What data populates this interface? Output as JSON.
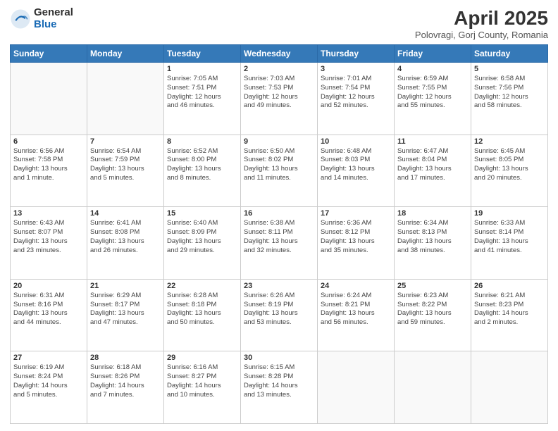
{
  "header": {
    "logo_general": "General",
    "logo_blue": "Blue",
    "month_title": "April 2025",
    "location": "Polovragi, Gorj County, Romania"
  },
  "days_of_week": [
    "Sunday",
    "Monday",
    "Tuesday",
    "Wednesday",
    "Thursday",
    "Friday",
    "Saturday"
  ],
  "weeks": [
    [
      {
        "day": "",
        "info": ""
      },
      {
        "day": "",
        "info": ""
      },
      {
        "day": "1",
        "info": "Sunrise: 7:05 AM\nSunset: 7:51 PM\nDaylight: 12 hours\nand 46 minutes."
      },
      {
        "day": "2",
        "info": "Sunrise: 7:03 AM\nSunset: 7:53 PM\nDaylight: 12 hours\nand 49 minutes."
      },
      {
        "day": "3",
        "info": "Sunrise: 7:01 AM\nSunset: 7:54 PM\nDaylight: 12 hours\nand 52 minutes."
      },
      {
        "day": "4",
        "info": "Sunrise: 6:59 AM\nSunset: 7:55 PM\nDaylight: 12 hours\nand 55 minutes."
      },
      {
        "day": "5",
        "info": "Sunrise: 6:58 AM\nSunset: 7:56 PM\nDaylight: 12 hours\nand 58 minutes."
      }
    ],
    [
      {
        "day": "6",
        "info": "Sunrise: 6:56 AM\nSunset: 7:58 PM\nDaylight: 13 hours\nand 1 minute."
      },
      {
        "day": "7",
        "info": "Sunrise: 6:54 AM\nSunset: 7:59 PM\nDaylight: 13 hours\nand 5 minutes."
      },
      {
        "day": "8",
        "info": "Sunrise: 6:52 AM\nSunset: 8:00 PM\nDaylight: 13 hours\nand 8 minutes."
      },
      {
        "day": "9",
        "info": "Sunrise: 6:50 AM\nSunset: 8:02 PM\nDaylight: 13 hours\nand 11 minutes."
      },
      {
        "day": "10",
        "info": "Sunrise: 6:48 AM\nSunset: 8:03 PM\nDaylight: 13 hours\nand 14 minutes."
      },
      {
        "day": "11",
        "info": "Sunrise: 6:47 AM\nSunset: 8:04 PM\nDaylight: 13 hours\nand 17 minutes."
      },
      {
        "day": "12",
        "info": "Sunrise: 6:45 AM\nSunset: 8:05 PM\nDaylight: 13 hours\nand 20 minutes."
      }
    ],
    [
      {
        "day": "13",
        "info": "Sunrise: 6:43 AM\nSunset: 8:07 PM\nDaylight: 13 hours\nand 23 minutes."
      },
      {
        "day": "14",
        "info": "Sunrise: 6:41 AM\nSunset: 8:08 PM\nDaylight: 13 hours\nand 26 minutes."
      },
      {
        "day": "15",
        "info": "Sunrise: 6:40 AM\nSunset: 8:09 PM\nDaylight: 13 hours\nand 29 minutes."
      },
      {
        "day": "16",
        "info": "Sunrise: 6:38 AM\nSunset: 8:11 PM\nDaylight: 13 hours\nand 32 minutes."
      },
      {
        "day": "17",
        "info": "Sunrise: 6:36 AM\nSunset: 8:12 PM\nDaylight: 13 hours\nand 35 minutes."
      },
      {
        "day": "18",
        "info": "Sunrise: 6:34 AM\nSunset: 8:13 PM\nDaylight: 13 hours\nand 38 minutes."
      },
      {
        "day": "19",
        "info": "Sunrise: 6:33 AM\nSunset: 8:14 PM\nDaylight: 13 hours\nand 41 minutes."
      }
    ],
    [
      {
        "day": "20",
        "info": "Sunrise: 6:31 AM\nSunset: 8:16 PM\nDaylight: 13 hours\nand 44 minutes."
      },
      {
        "day": "21",
        "info": "Sunrise: 6:29 AM\nSunset: 8:17 PM\nDaylight: 13 hours\nand 47 minutes."
      },
      {
        "day": "22",
        "info": "Sunrise: 6:28 AM\nSunset: 8:18 PM\nDaylight: 13 hours\nand 50 minutes."
      },
      {
        "day": "23",
        "info": "Sunrise: 6:26 AM\nSunset: 8:19 PM\nDaylight: 13 hours\nand 53 minutes."
      },
      {
        "day": "24",
        "info": "Sunrise: 6:24 AM\nSunset: 8:21 PM\nDaylight: 13 hours\nand 56 minutes."
      },
      {
        "day": "25",
        "info": "Sunrise: 6:23 AM\nSunset: 8:22 PM\nDaylight: 13 hours\nand 59 minutes."
      },
      {
        "day": "26",
        "info": "Sunrise: 6:21 AM\nSunset: 8:23 PM\nDaylight: 14 hours\nand 2 minutes."
      }
    ],
    [
      {
        "day": "27",
        "info": "Sunrise: 6:19 AM\nSunset: 8:24 PM\nDaylight: 14 hours\nand 5 minutes."
      },
      {
        "day": "28",
        "info": "Sunrise: 6:18 AM\nSunset: 8:26 PM\nDaylight: 14 hours\nand 7 minutes."
      },
      {
        "day": "29",
        "info": "Sunrise: 6:16 AM\nSunset: 8:27 PM\nDaylight: 14 hours\nand 10 minutes."
      },
      {
        "day": "30",
        "info": "Sunrise: 6:15 AM\nSunset: 8:28 PM\nDaylight: 14 hours\nand 13 minutes."
      },
      {
        "day": "",
        "info": ""
      },
      {
        "day": "",
        "info": ""
      },
      {
        "day": "",
        "info": ""
      }
    ]
  ]
}
